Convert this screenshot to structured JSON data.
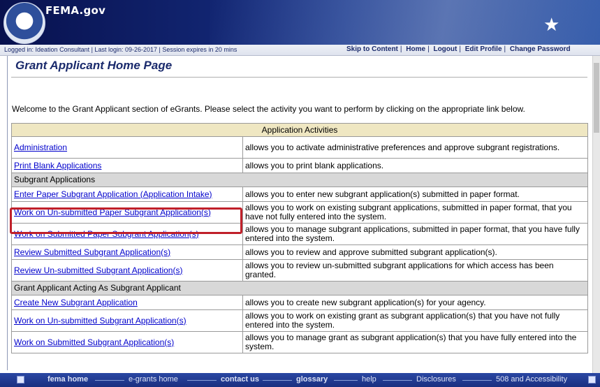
{
  "header": {
    "site_name": "FEMA.gov",
    "login_info": "Logged in: Ideation Consultant  |  Last login: 09-26-2017  |  Session expires in 20 mins",
    "links": [
      "Skip to Content",
      "Home",
      "Logout",
      "Edit Profile",
      "Change Password"
    ]
  },
  "page": {
    "title": "Grant Applicant Home Page",
    "welcome": "Welcome to the Grant Applicant section of eGrants. Please select the activity you want to perform by clicking on the appropriate link below."
  },
  "table": {
    "header": "Application Activities",
    "rows": [
      {
        "link": "Administration",
        "desc": "allows you to activate administrative preferences and approve subgrant registrations."
      },
      {
        "link": "Print Blank Applications",
        "desc": "allows you to print blank applications."
      },
      {
        "section": "Subgrant Applications"
      },
      {
        "link": "Enter Paper Subgrant Application (Application Intake)",
        "desc": "allows you to enter new subgrant application(s) submitted in paper format."
      },
      {
        "link": "Work on Un-submitted Paper Subgrant Application(s)",
        "desc": "allows you to work on existing subgrant applications, submitted in paper format, that you have not fully entered into the system."
      },
      {
        "link": "Work on Submitted Paper Subgrant Application(s)",
        "desc": "allows you to manage subgrant applications, submitted in paper format, that you have fully entered into the system."
      },
      {
        "link": "Review Submitted Subgrant Application(s)",
        "desc": "allows you to review and approve submitted subgrant application(s)."
      },
      {
        "link": "Review Un-submitted Subgrant Application(s)",
        "desc": "allows you to review un-submitted subgrant applications for which access has been granted."
      },
      {
        "section": "Grant Applicant Acting As Subgrant Applicant"
      },
      {
        "link": "Create New Subgrant Application",
        "desc": "allows you to create new subgrant application(s) for your agency."
      },
      {
        "link": "Work on Un-submitted Subgrant Application(s)",
        "desc": "allows you to work on existing grant as subgrant application(s) that you have not fully entered into the system."
      },
      {
        "link": "Work on Submitted Subgrant Application(s)",
        "desc": "allows you to manage grant as subgrant application(s) that you have fully entered into the system."
      }
    ]
  },
  "footer": {
    "links": [
      "fema home",
      "e-grants home",
      "contact us",
      "glossary",
      "help",
      "Disclosures",
      "508 and Accessibility"
    ]
  },
  "colors": {
    "highlight": "#c0202a",
    "link": "#0000cc",
    "banner": "#142a7a"
  }
}
